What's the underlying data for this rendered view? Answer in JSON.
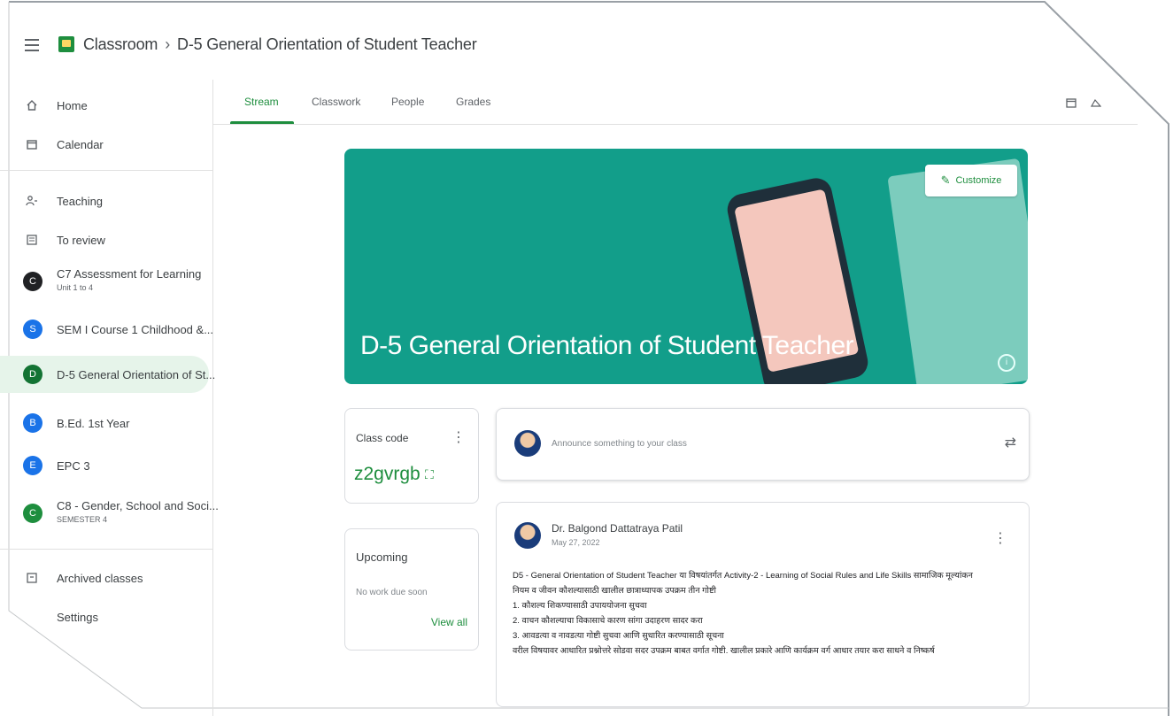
{
  "header": {
    "menu_icon": "hamburger-menu-icon",
    "app_name": "Classroom",
    "separator": "›",
    "class_title": "D-5 General Orientation of Student Teacher"
  },
  "sidebar": {
    "items": [
      {
        "label": "Home",
        "icon": "home-icon"
      },
      {
        "label": "Calendar",
        "icon": "calendar-icon"
      },
      {
        "label": "Teaching",
        "icon": "teaching-icon"
      },
      {
        "label": "To review",
        "icon": "to-review-icon"
      }
    ],
    "classes": [
      {
        "letter": "C",
        "label": "C7 Assessment for Learning",
        "sub": "Unit 1 to 4",
        "color": "#202124"
      },
      {
        "letter": "S",
        "label": "SEM I Course 1 Childhood &...",
        "sub": "",
        "color": "#1a73e8"
      },
      {
        "letter": "D",
        "label": "D-5 General Orientation of St...",
        "sub": "",
        "color": "#137333"
      },
      {
        "letter": "B",
        "label": "B.Ed. 1st Year",
        "sub": "",
        "color": "#1a73e8"
      },
      {
        "letter": "E",
        "label": "EPC 3",
        "sub": "",
        "color": "#1a73e8"
      },
      {
        "letter": "C",
        "label": "C8 - Gender, School and Soci...",
        "sub": "SEMESTER 4",
        "color": "#1e8e3e"
      }
    ],
    "archived": {
      "label": "Archived classes",
      "icon": "archive-icon"
    },
    "settings": {
      "label": "Settings",
      "icon": "settings-icon"
    }
  },
  "tabs": {
    "items": [
      "Stream",
      "Classwork",
      "People",
      "Grades"
    ],
    "active": "Stream",
    "right_icons": [
      "calendar-icon",
      "drive-folder-icon"
    ]
  },
  "banner": {
    "title": "D-5 General Orientation of Student Teacher",
    "customize_label": "Customize",
    "color": "#129e8a"
  },
  "class_code": {
    "title": "Class code",
    "value": "z2gvrgb"
  },
  "upcoming": {
    "title": "Upcoming",
    "empty": "No work due soon",
    "view_all": "View all"
  },
  "announce": {
    "placeholder": "Announce something to your class"
  },
  "post": {
    "author": "Dr. Balgond Dattatraya Patil",
    "date": "May 27, 2022",
    "lines": [
      "D5 - General Orientation of Student Teacher या विषयांतर्गत Activity-2 - Learning of Social Rules and Life Skills सामाजिक मूल्यांकन",
      "नियम व जीवन कौशल्यासाठी खालील छात्राध्यापक उपक्रम तीन गोष्टी",
      "1. कौशल्य शिकण्यासाठी उपाययोजना सुचवा",
      "2. वाचन कौशल्याचा विकासाचे कारण सांगा उदाहरण सादर करा",
      "3. आवडत्या व नावडत्या गोष्टी सुचवा आणि सुधारित करण्यासाठी सूचना",
      "वरील विषयावर आधारित प्रश्नोत्तरे सोडवा सदर उपक्रम बाबत वर्गात गोष्टी. खालील प्रकारे आणि कार्यक्रम वर्ग आधार तयार करा साधने व निष्कर्ष"
    ]
  }
}
